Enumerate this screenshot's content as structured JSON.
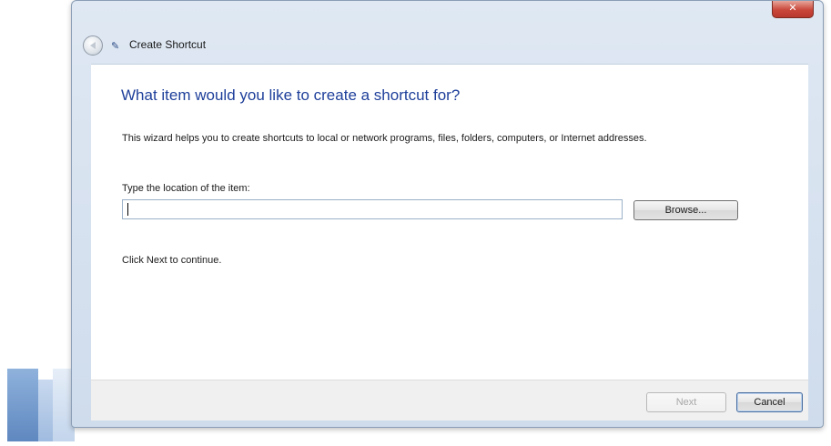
{
  "window": {
    "close_glyph": "✕",
    "title": "Create Shortcut",
    "back_icon": "back-arrow-icon",
    "wizard_icon": "shortcut-wizard-icon"
  },
  "main": {
    "heading": "What item would you like to create a shortcut for?",
    "description": "This wizard helps you to create shortcuts to local or network programs, files, folders, computers, or Internet addresses.",
    "location_label": "Type the location of the item:",
    "location_value": "",
    "browse_label": "Browse...",
    "continue_note": "Click Next to continue."
  },
  "footer": {
    "next_label": "Next",
    "next_enabled": false,
    "cancel_label": "Cancel"
  },
  "colors": {
    "heading": "#1e3f9a",
    "close_button": "#c9463a",
    "frame": "#dfe8f3"
  }
}
